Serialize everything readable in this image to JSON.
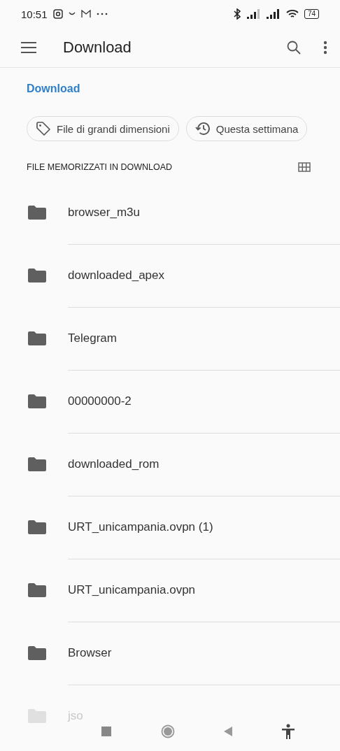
{
  "status_bar": {
    "time": "10:51",
    "battery": "74"
  },
  "app_bar": {
    "title": "Download"
  },
  "breadcrumb": "Download",
  "chips": [
    {
      "label": "File di grandi dimensioni",
      "kind": "tag"
    },
    {
      "label": "Questa settimana",
      "kind": "recent"
    }
  ],
  "section": {
    "title": "FILE MEMORIZZATI IN DOWNLOAD"
  },
  "folders": [
    {
      "name": "browser_m3u"
    },
    {
      "name": "downloaded_apex"
    },
    {
      "name": "Telegram"
    },
    {
      "name": "00000000-2"
    },
    {
      "name": "downloaded_rom"
    },
    {
      "name": "URT_unicampania.ovpn (1)"
    },
    {
      "name": "URT_unicampania.ovpn"
    },
    {
      "name": "Browser"
    },
    {
      "name": "jso"
    }
  ]
}
